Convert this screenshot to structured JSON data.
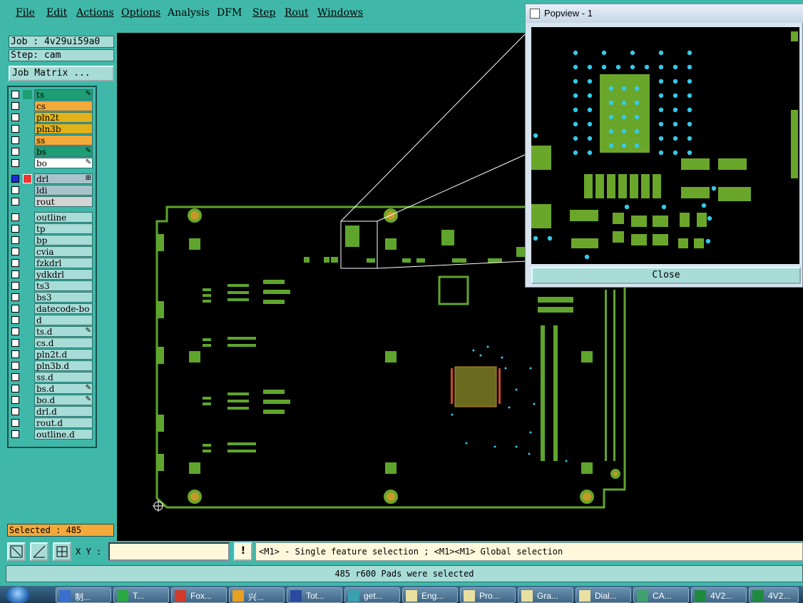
{
  "menu": [
    "File",
    "Edit",
    "Actions",
    "Options",
    "Analysis",
    "DFM",
    "Step",
    "Rout",
    "Windows"
  ],
  "job": {
    "job_label": "Job : 4v29ui59a0",
    "step_label": "Step: cam",
    "matrix_button": "Job Matrix ..."
  },
  "layers": [
    {
      "name": "ts",
      "color": "#1e9e74",
      "icon": "brush-icon"
    },
    {
      "name": "cs",
      "color": "#f4a93b"
    },
    {
      "name": "pln2t",
      "color": "#e2b21a"
    },
    {
      "name": "pln3b",
      "color": "#e2b21a"
    },
    {
      "name": "ss",
      "color": "#f4a93b"
    },
    {
      "name": "bs",
      "color": "#1e9e74",
      "icon": "brush-icon"
    },
    {
      "name": "bo",
      "color": "#ffffff",
      "icon": "brush-icon"
    },
    {
      "name": "drl",
      "color": "#a9c3cb",
      "icon": "grid-icon"
    },
    {
      "name": "ldi",
      "color": "#a9c3cb"
    },
    {
      "name": "rout",
      "color": "#d4d4d4"
    },
    {
      "name": "outline",
      "color": "#a8dcd7"
    },
    {
      "name": "tp",
      "color": "#a8dcd7"
    },
    {
      "name": "bp",
      "color": "#a8dcd7"
    },
    {
      "name": "cvia",
      "color": "#a8dcd7"
    },
    {
      "name": "fzkdrl",
      "color": "#a8dcd7"
    },
    {
      "name": "ydkdrl",
      "color": "#a8dcd7"
    },
    {
      "name": "ts3",
      "color": "#a8dcd7"
    },
    {
      "name": "bs3",
      "color": "#a8dcd7"
    },
    {
      "name": "datecode-bo",
      "color": "#a8dcd7"
    },
    {
      "name": "d",
      "color": "#a8dcd7"
    },
    {
      "name": "ts.d",
      "color": "#a8dcd7",
      "icon": "brush-icon"
    },
    {
      "name": "cs.d",
      "color": "#a8dcd7"
    },
    {
      "name": "pln2t.d",
      "color": "#a8dcd7"
    },
    {
      "name": "pln3b.d",
      "color": "#a8dcd7"
    },
    {
      "name": "ss.d",
      "color": "#a8dcd7"
    },
    {
      "name": "bs.d",
      "color": "#a8dcd7",
      "icon": "brush-icon"
    },
    {
      "name": "bo.d",
      "color": "#a8dcd7",
      "icon": "brush-icon"
    },
    {
      "name": "drl.d",
      "color": "#a8dcd7"
    },
    {
      "name": "rout.d",
      "color": "#a8dcd7"
    },
    {
      "name": "outline.d",
      "color": "#a8dcd7"
    }
  ],
  "selected": "Selected : 485",
  "popview": {
    "title": "Popview - 1",
    "close_label": "Close"
  },
  "toolbar": {
    "xy_label": "X Y :",
    "xy_value": "",
    "bang": "!",
    "hint": "<M1> - Single feature selection ; <M1><M1> Global selection"
  },
  "status": "485 r600 Pads were selected",
  "colors": {
    "board": "#5fa52d",
    "pad": "#6aa62a",
    "via": "#35c9e8",
    "bg": "#3fb8a9",
    "highlight": "#e03030"
  },
  "taskbar": [
    {
      "label": "制...",
      "icon": "document-icon"
    },
    {
      "label": "T...",
      "icon": "app-icon"
    },
    {
      "label": "Fox...",
      "icon": "foxit-icon"
    },
    {
      "label": "兴...",
      "icon": "flower-icon"
    },
    {
      "label": "Tot...",
      "icon": "floppy-icon"
    },
    {
      "label": "get...",
      "icon": "eye-icon"
    },
    {
      "label": "Eng...",
      "icon": "window-icon"
    },
    {
      "label": "Pro...",
      "icon": "window-icon"
    },
    {
      "label": "Gra...",
      "icon": "window-icon"
    },
    {
      "label": "Dial...",
      "icon": "window-icon"
    },
    {
      "label": "CA...",
      "icon": "network-icon"
    },
    {
      "label": "4V2...",
      "icon": "excel-icon"
    },
    {
      "label": "4V2...",
      "icon": "excel-icon"
    }
  ]
}
